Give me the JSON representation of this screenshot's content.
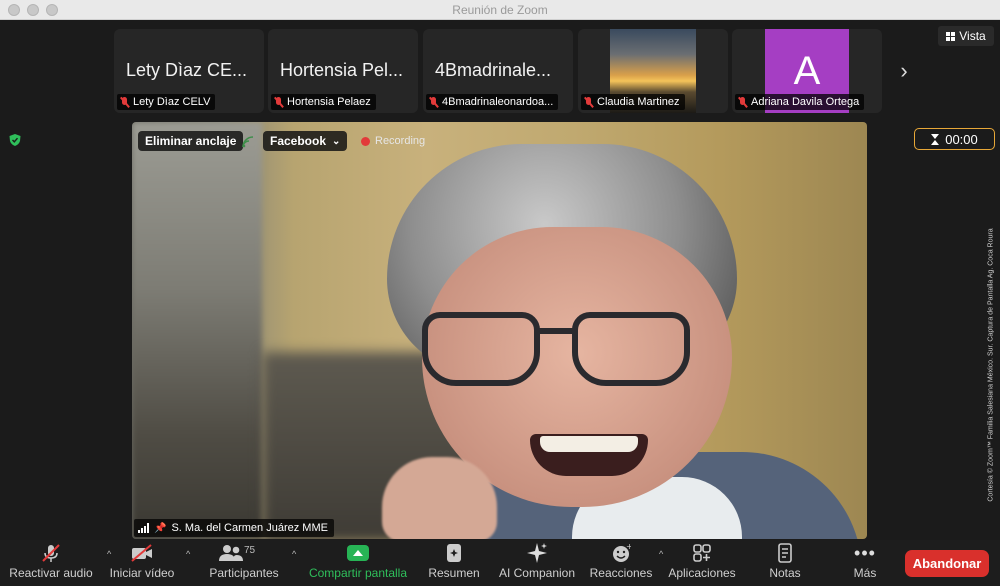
{
  "window": {
    "title": "Reunión de Zoom"
  },
  "view_button": {
    "label": "Vista"
  },
  "participants_strip": [
    {
      "big_name": "Lety Dìaz CE...",
      "label": "Lety Dìaz CELV"
    },
    {
      "big_name": "Hortensia Pel...",
      "label": "Hortensia Pelaez"
    },
    {
      "big_name": "4Bmadrinale...",
      "label": "4Bmadrinaleonardoa..."
    },
    {
      "label": "Claudia Martinez"
    },
    {
      "avatar_letter": "A",
      "avatar_color": "#a53ec3",
      "label": "Adriana Davila Ortega"
    }
  ],
  "timer": {
    "value": "00:00",
    "accent": "#e8a838"
  },
  "video": {
    "unpin_label": "Eliminar anclaje",
    "stream_label": "Facebook",
    "recording_label": "Recording",
    "speaker_name": "S. Ma. del Carmen Juárez MME"
  },
  "credit": "Cortesía © Zoom™ Familia Salesiana México. Sur. Captura de Pantalla Ag. Coca Roura",
  "toolbar": {
    "unmute": "Reactivar audio",
    "start_video": "Iniciar vídeo",
    "participants": "Participantes",
    "participants_count": "75",
    "share_screen": "Compartir pantalla",
    "summary": "Resumen",
    "ai_companion": "AI Companion",
    "reactions": "Reacciones",
    "apps": "Aplicaciones",
    "notes": "Notas",
    "more": "Más",
    "leave": "Abandonar"
  },
  "colors": {
    "share_green": "#27b455",
    "leave_red": "#d9302c",
    "mute_red": "#e23a3a"
  }
}
